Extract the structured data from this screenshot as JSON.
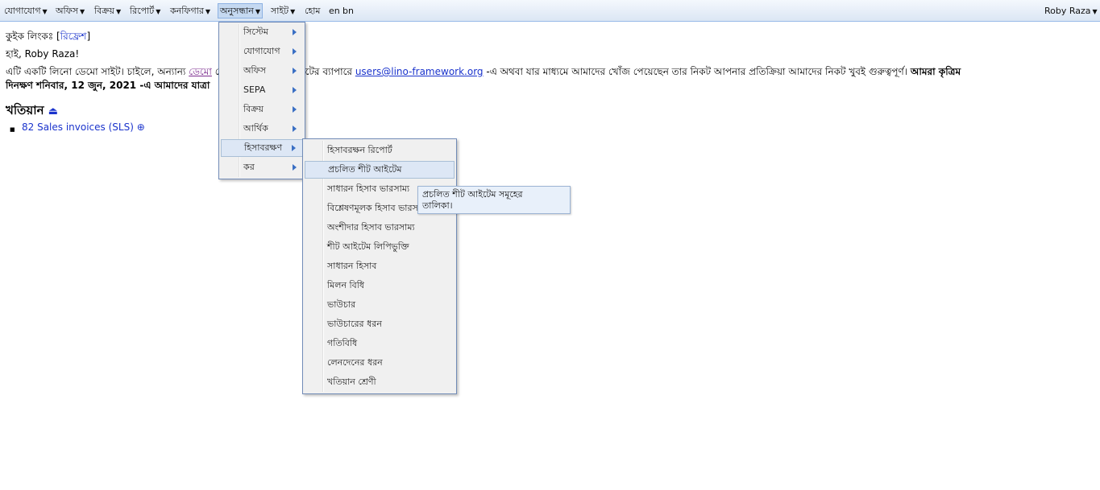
{
  "menubar": {
    "items": [
      "যোগাযোগ",
      "অফিস",
      "বিক্রয়",
      "রিপোর্ট",
      "কনফিগার",
      "অনুসন্ধান",
      "সাইট",
      "হোম",
      "en",
      "bn"
    ],
    "user": "Roby Raza"
  },
  "content": {
    "quick_links_label": "কুইক লিংকঃ [",
    "quick_links_refresh": "রিফ্রেশ",
    "quick_links_close": "]",
    "greeting": "হাই, Roby Raza!",
    "intro_a": "এটি একটি লিনো ডেমো সাইট। চাইলে, অন্যান্য ",
    "intro_link": "ডেমো",
    "intro_b": " দেখতে পারেন। এই সাইটের ব্যাপারে ",
    "email": "users@lino-framework.org",
    "intro_c": " -এ অথবা যার মাধ্যমে আমাদের খোঁজ পেয়েছেন তার নিকট আপনার প্রতিক্রিয়া আমাদের নিকট খুবই গুরুত্বপূর্ণ। ",
    "intro_bold_end": "আমরা কৃত্রিম",
    "date_line": "দিনক্ষণ শনিবার, 12 জুন, 2021 -এ আমাদের যাত্রা",
    "heading": "খতিয়ান",
    "heading_icon": "eject-icon",
    "list_item": "82 Sales invoices (SLS)",
    "list_item_icon": "add-circle-icon"
  },
  "explorer_menu": {
    "items": [
      "সিস্টেম",
      "যোগাযোগ",
      "অফিস",
      "SEPA",
      "বিক্রয়",
      "আর্থিক",
      "হিসাবরক্ষণ",
      "কর"
    ]
  },
  "accounting_submenu": {
    "items": [
      "হিসাবরক্ষন রিপোর্ট",
      "প্রচলিত শীট আইটেম",
      "সাধারন হিসাব ভারসাম্য",
      "বিশ্লেষণমূলক হিসাব ভারসাম্য",
      "অংশীদার হিসাব ভারসাম্য",
      "শীট আইটেম লিপিভুক্তি",
      "সাধারন হিসাব",
      "মিলন বিধি",
      "ভাউচার",
      "ভাউচারের ধরন",
      "গতিবিধি",
      "লেনদেনের ধরন",
      "খতিয়ান শ্রেণী"
    ]
  },
  "tooltip": {
    "line1": "প্রচলিত শীট আইটেম সমূহের",
    "line2": "তালিকা।"
  }
}
